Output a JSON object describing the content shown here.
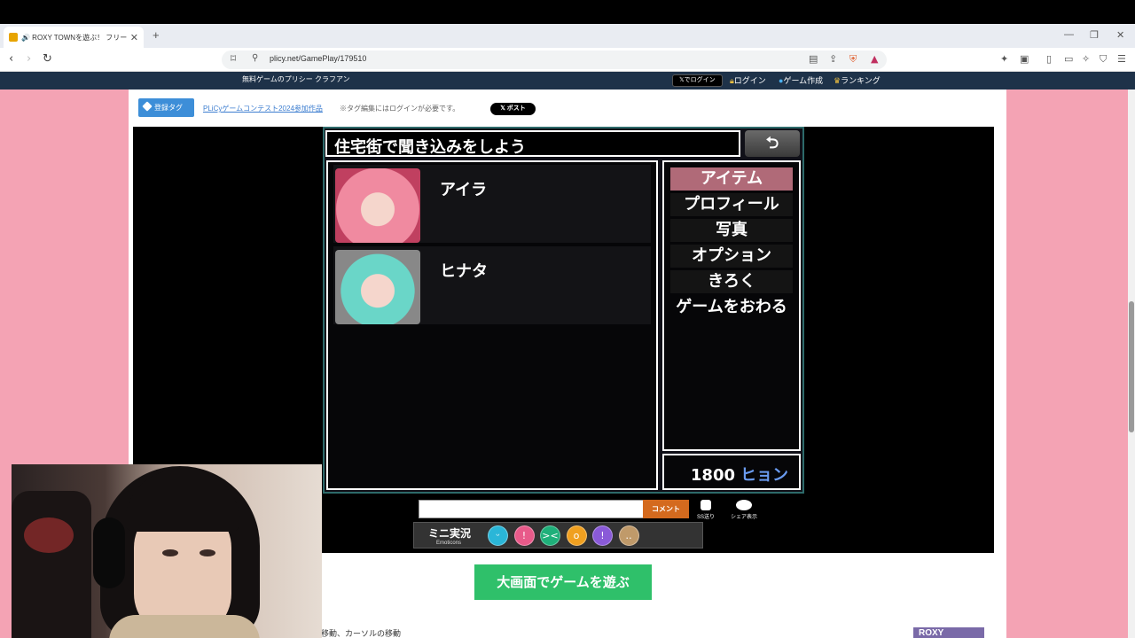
{
  "browser": {
    "tab_title": "🔊 ROXY TOWNを遊ぶ！ フリーゲ",
    "url": "plicy.net/GamePlay/179510"
  },
  "site_nav": {
    "brand": "無料ゲームのプリシー クラフアン",
    "x_login": "𝕏でログイン",
    "login": "ログイン",
    "create": "ゲーム作成",
    "ranking": "ランキング"
  },
  "tags": {
    "badge": "登録タグ",
    "link": "PLiCyゲームコンテスト2024参加作品",
    "note": "※タグ編集にはログインが必要です。",
    "post_button": "𝕏 ポスト"
  },
  "game": {
    "title": "住宅街で聞き込みをしよう",
    "back_symbol": "⮌",
    "party": [
      {
        "name": "アイラ",
        "hair_color": "#f08aa0"
      },
      {
        "name": "ヒナタ",
        "hair_color": "#6ad6c8"
      }
    ],
    "menu": [
      "アイテム",
      "プロフィール",
      "写真",
      "オプション",
      "きろく",
      "ゲームをおわる"
    ],
    "selected_menu_index": 0,
    "money": {
      "amount": "1800",
      "unit": "ヒョン"
    }
  },
  "comment": {
    "button": "コメント",
    "ss_label": "SS送り",
    "share_label": "シェア表示",
    "emo_label": "ミニ実況",
    "emo_sub": "Emoticons",
    "emoticons": [
      {
        "name": "happy-emoticon",
        "color": "#2ab6d8",
        "glyph": "ᵕ"
      },
      {
        "name": "love-emoticon",
        "color": "#e85a8a",
        "glyph": "!"
      },
      {
        "name": "laugh-emoticon",
        "color": "#1fb07a",
        "glyph": "><"
      },
      {
        "name": "surprise-emoticon",
        "color": "#f0a020",
        "glyph": "o"
      },
      {
        "name": "sad-emoticon",
        "color": "#8a5ad8",
        "glyph": "!"
      },
      {
        "name": "neutral-emoticon",
        "color": "#c09a6a",
        "glyph": "‥"
      }
    ]
  },
  "big_button": "大画面でゲームを遊ぶ",
  "hint": "移動、カーソルの移動",
  "roxy_banner": "ROXY"
}
